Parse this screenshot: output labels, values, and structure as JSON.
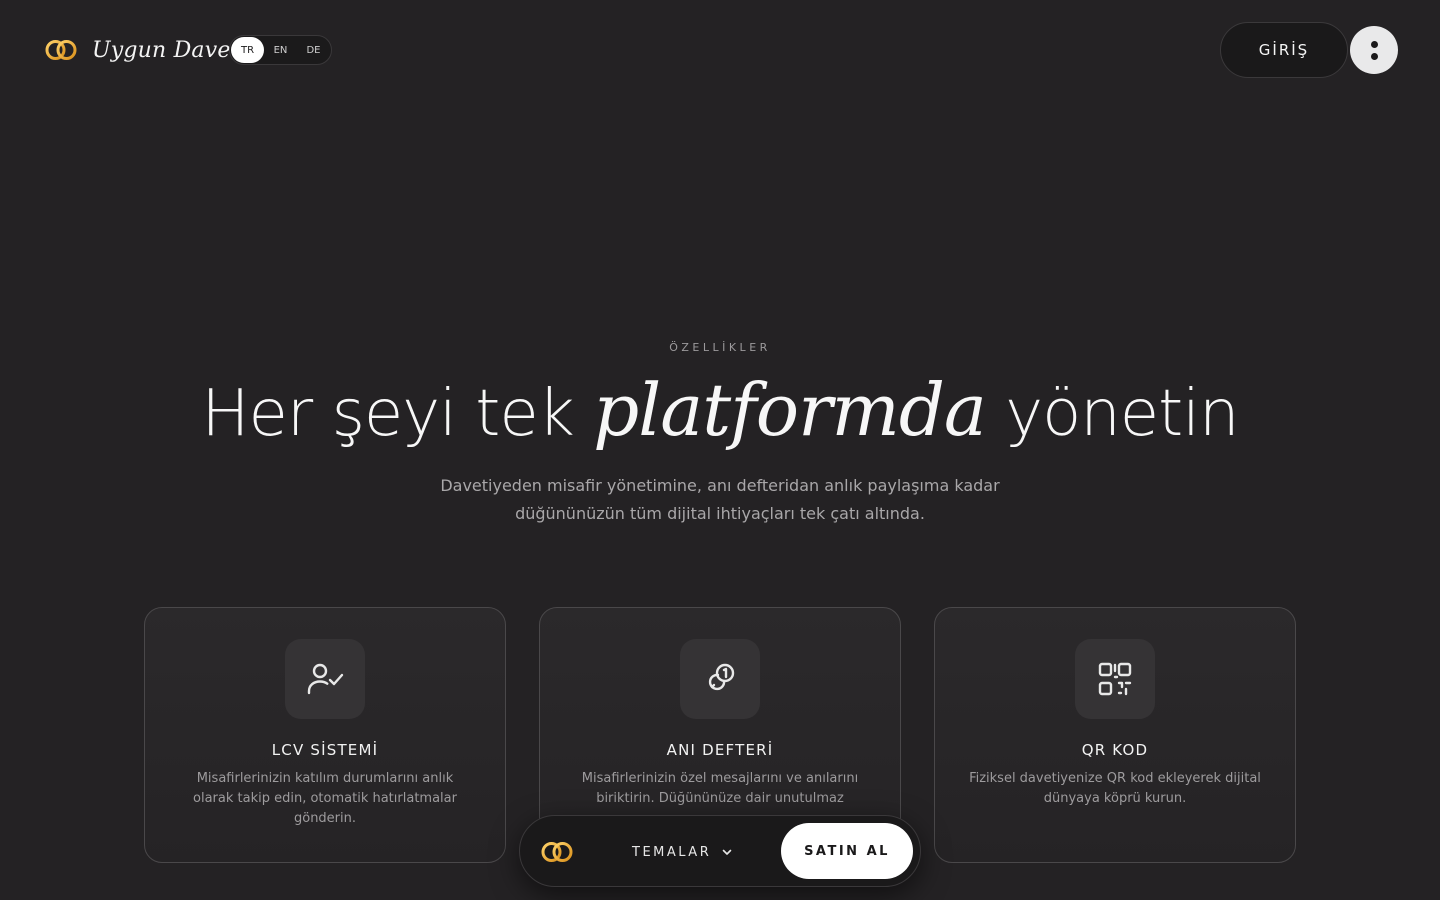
{
  "header": {
    "brand_name": "Uygun Davet",
    "brand_icon": "wedding-rings-icon",
    "languages": [
      {
        "code": "TR",
        "active": true
      },
      {
        "code": "EN",
        "active": false
      },
      {
        "code": "DE",
        "active": false
      }
    ],
    "login_label": "GİRİŞ",
    "menu_icon": "vertical-dots-icon"
  },
  "hero": {
    "eyebrow": "ÖZELLİKLER",
    "title_before": "Her şeyi tek",
    "title_accent": "platformda",
    "title_after": "yönetin",
    "subtitle_line1": "Davetiyeden misafir yönetimine, anı defteridan anlık paylaşıma kadar",
    "subtitle_line2": "düğününüzün tüm dijital ihtiyaçları tek çatı altında."
  },
  "features": [
    {
      "icon": "user-check-icon",
      "title": "LCV SİSTEMİ",
      "description": "Misafirlerinizin katılım durumlarını anlık olarak takip edin, otomatik hatırlatmalar gönderin."
    },
    {
      "icon": "link-badge-icon",
      "title": "ANI DEFTERİ",
      "description": "Misafirlerinizin özel mesajlarını ve anılarını biriktirin. Düğününüze dair unutulmaz"
    },
    {
      "icon": "qr-code-icon",
      "title": "QR KOD",
      "description": "Fiziksel davetiyenize QR kod ekleyerek dijital dünyaya köprü kurun."
    }
  ],
  "bottom_nav": {
    "logo_icon": "wedding-rings-icon",
    "themes_label": "TEMALAR",
    "themes_icon": "chevron-down-icon",
    "buy_label": "SATIN AL"
  },
  "colors": {
    "background": "#242224",
    "ring_gold": "#e8a72c",
    "card_border": "#4a484a",
    "button_light": "#ffffff"
  }
}
